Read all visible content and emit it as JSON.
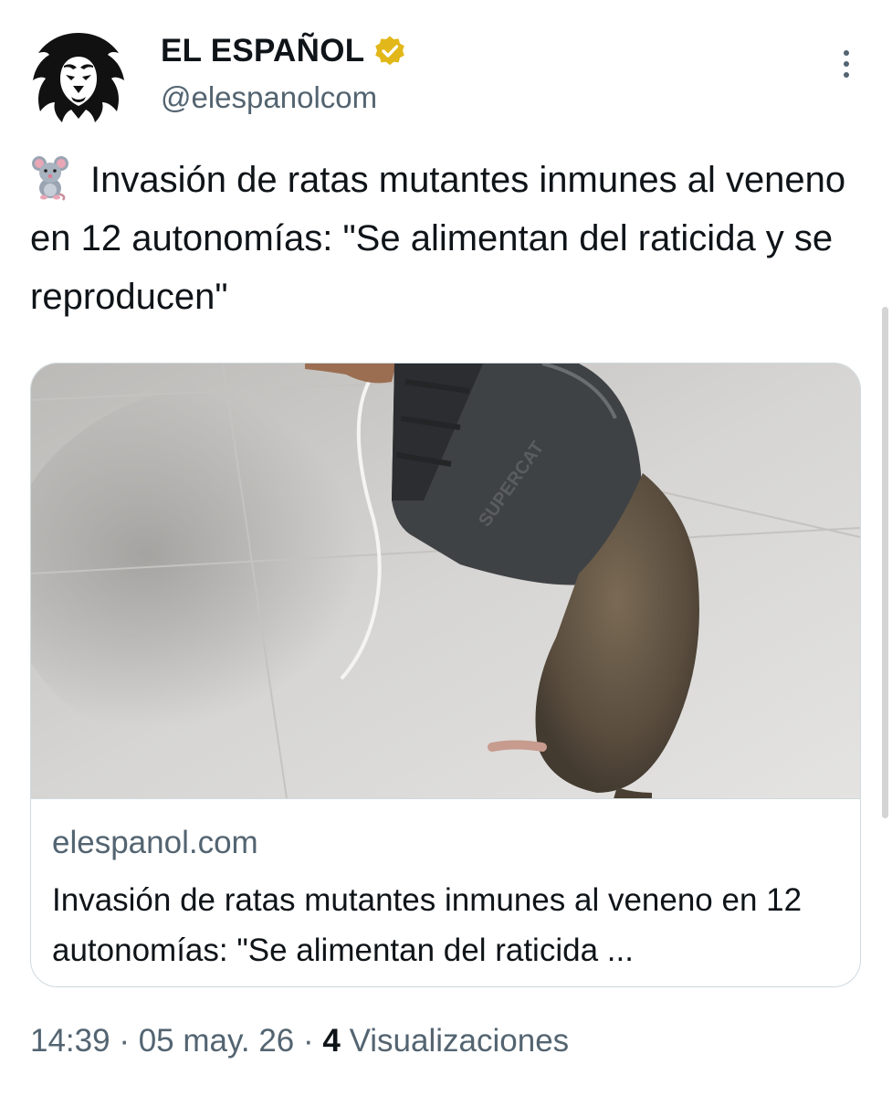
{
  "author": {
    "display_name": "EL ESPAÑOL",
    "handle": "@elespanolcom",
    "verified_color": "#e2b719"
  },
  "tweet": {
    "emoji": "mouse-emoji",
    "text": "Invasión de ratas mutantes inmunes al veneno en 12 autonomías: \"Se alimentan del raticida y se reproducen\""
  },
  "card": {
    "image_icon": "rat-trap-photo",
    "trap_label": "SUPERCAT",
    "domain": "elespanol.com",
    "title": "Invasión de ratas mutantes inmunes al veneno en 12 autonomías: \"Se alimentan del raticida ..."
  },
  "meta": {
    "time": "14:39",
    "sep1": " · ",
    "date": "05 may. 26",
    "sep2": " · ",
    "views_count": "4",
    "views_label": " Visualizaciones"
  },
  "colors": {
    "text_primary": "#0f1419",
    "text_secondary": "#536471",
    "border": "#cfd9de"
  }
}
